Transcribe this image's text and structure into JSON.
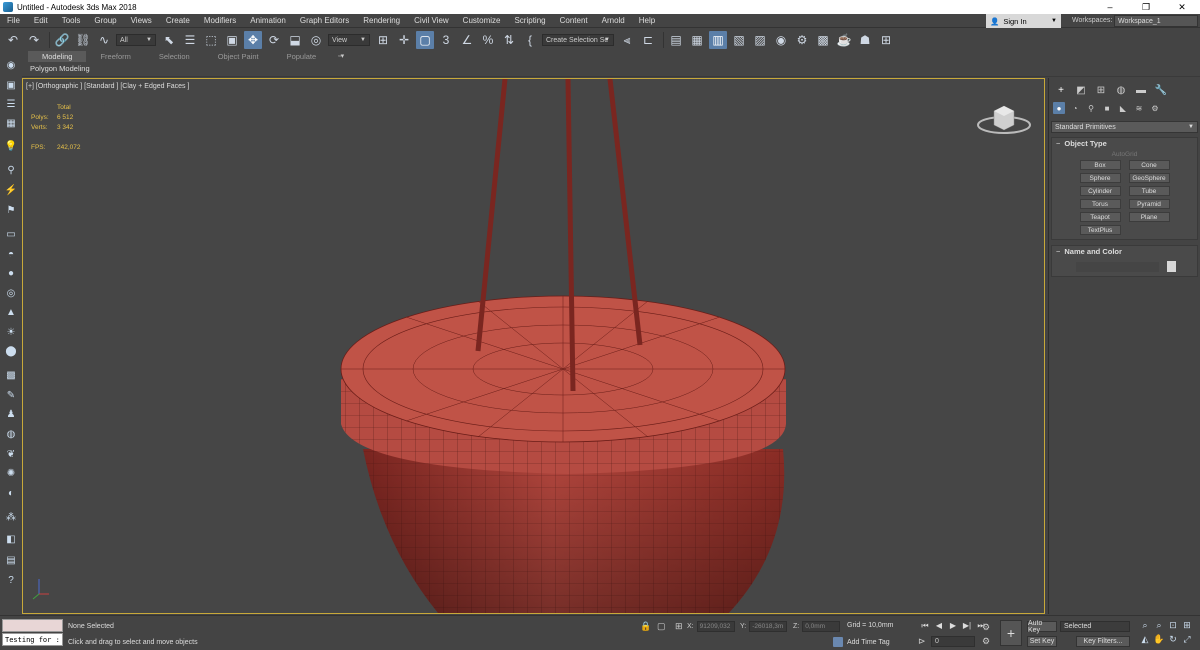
{
  "window": {
    "title": "Untitled - Autodesk 3ds Max 2018",
    "controls": [
      "–",
      "❐",
      "✕"
    ]
  },
  "menu": {
    "items": [
      "File",
      "Edit",
      "Tools",
      "Group",
      "Views",
      "Create",
      "Modifiers",
      "Animation",
      "Graph Editors",
      "Rendering",
      "Civil View",
      "Customize",
      "Scripting",
      "Content",
      "Arnold",
      "Help"
    ],
    "sign_in": "Sign In",
    "workspaces_label": "Workspaces:",
    "workspace_value": "Workspace_1"
  },
  "toolbar": {
    "selection_filter": "All",
    "reference_coord": "View",
    "named_selection": "Create Selection Se"
  },
  "ribbon": {
    "tabs": [
      "Modeling",
      "Freeform",
      "Selection",
      "Object Paint",
      "Populate"
    ],
    "active_tab": "Modeling",
    "extra": "▫▾",
    "sub_label": "Polygon Modeling"
  },
  "viewport": {
    "label": "[+] [Orthographic ] [Standard ] [Clay + Edged Faces ]",
    "stats": {
      "total_label": "Total",
      "polys_label": "Polys:",
      "polys_value": "6 512",
      "verts_label": "Verts:",
      "verts_value": "3 342",
      "fps_label": "FPS:",
      "fps_value": "242,072"
    },
    "colors": {
      "object": "#b0453d",
      "border": "#c8a93a",
      "background": "#464646"
    }
  },
  "command_panel": {
    "category": "Standard Primitives",
    "object_type": {
      "title": "Object Type",
      "autogrid": "AutoGrid",
      "buttons": [
        "Box",
        "Cone",
        "Sphere",
        "GeoSphere",
        "Cylinder",
        "Tube",
        "Torus",
        "Pyramid",
        "Teapot",
        "Plane",
        "TextPlus"
      ]
    },
    "name_and_color": {
      "title": "Name and Color"
    }
  },
  "status": {
    "maxscript_output": "Testing for :",
    "selection": "None Selected",
    "prompt": "Click and drag to select and move objects",
    "x_label": "X:",
    "x_value": "91209,032",
    "y_label": "Y:",
    "y_value": "-26018,3m",
    "z_label": "Z:",
    "z_value": "0,0mm",
    "grid": "Grid = 10,0mm",
    "add_time_tag": "Add Time Tag",
    "frame": "0",
    "auto_key": "Auto Key",
    "set_key": "Set Key",
    "key_mode": "Selected",
    "key_filters": "Key Filters..."
  }
}
